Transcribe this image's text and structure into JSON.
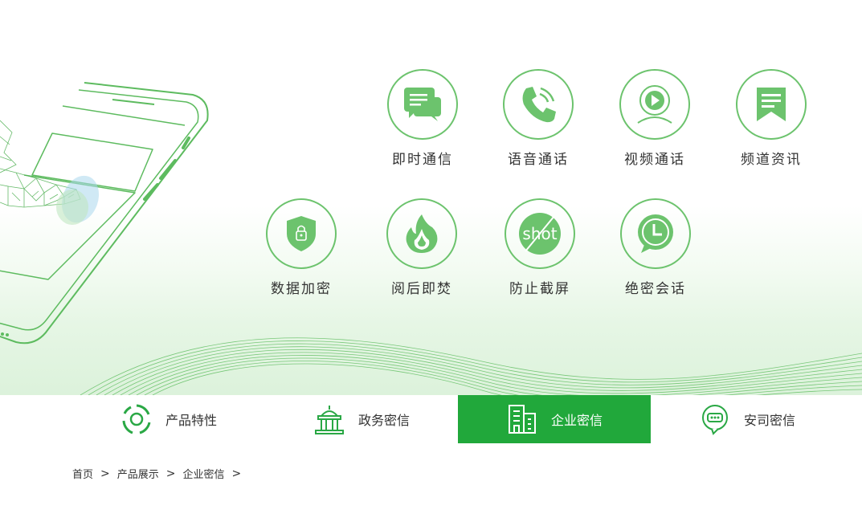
{
  "features": {
    "row1": [
      {
        "label": "即时通信",
        "icon": "chat-bubbles-icon"
      },
      {
        "label": "语音通话",
        "icon": "phone-icon"
      },
      {
        "label": "视频通话",
        "icon": "webcam-icon"
      },
      {
        "label": "频道资讯",
        "icon": "news-bookmark-icon"
      }
    ],
    "row2": [
      {
        "label": "数据加密",
        "icon": "shield-lock-icon"
      },
      {
        "label": "阅后即焚",
        "icon": "flame-icon"
      },
      {
        "label": "防止截屏",
        "icon": "no-screenshot-icon",
        "icon_text": "shot"
      },
      {
        "label": "绝密会话",
        "icon": "clock-chat-icon"
      }
    ]
  },
  "tabs": [
    {
      "label": "产品特性",
      "icon": "product-features-icon",
      "active": false
    },
    {
      "label": "政务密信",
      "icon": "government-building-icon",
      "active": false
    },
    {
      "label": "企业密信",
      "icon": "enterprise-building-icon",
      "active": true
    },
    {
      "label": "安司密信",
      "icon": "chat-bubble-icon",
      "active": false
    }
  ],
  "breadcrumb": [
    {
      "label": "首页"
    },
    {
      "label": "产品展示"
    },
    {
      "label": "企业密信"
    }
  ],
  "colors": {
    "accent": "#21a83b",
    "icon_green": "#6cc36d",
    "text": "#333333"
  }
}
